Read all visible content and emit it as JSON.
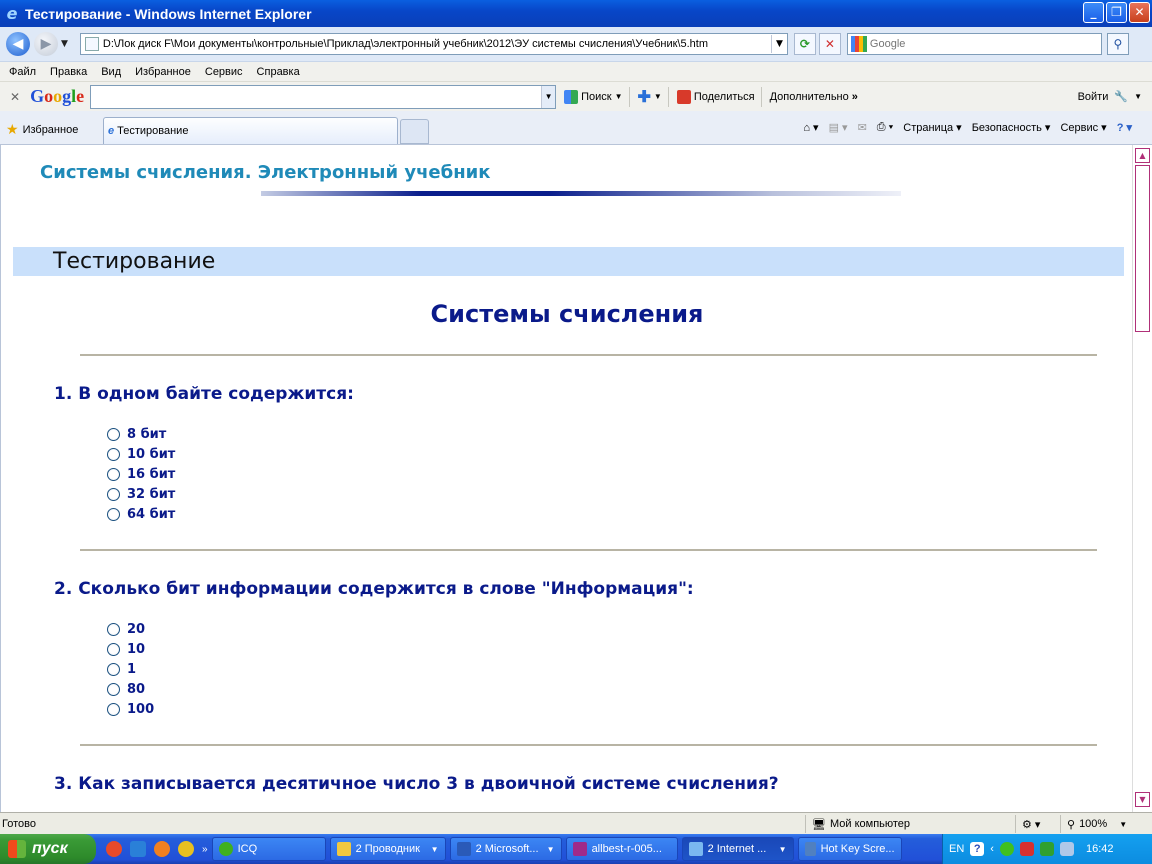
{
  "window": {
    "title": "Тестирование - Windows Internet Explorer"
  },
  "address": {
    "url": "D:\\Лок диск F\\Мои документы\\контрольные\\Приклад\\электронный учебник\\2012\\ЭУ системы счисления\\Учебник\\5.htm",
    "search_placeholder": "Google"
  },
  "menu": [
    "Файл",
    "Правка",
    "Вид",
    "Избранное",
    "Сервис",
    "Справка"
  ],
  "google_toolbar": {
    "logo": "Google",
    "search_label": "Поиск",
    "share_label": "Поделиться",
    "more_label": "Дополнительно",
    "login_label": "Войти"
  },
  "tabs": {
    "favorites_label": "Избранное",
    "active_tab": "Тестирование",
    "commands": {
      "page": "Страница",
      "safety": "Безопасность",
      "tools": "Сервис"
    }
  },
  "page": {
    "site_title": "Системы счисления. Электронный учебник",
    "section": "Тестирование",
    "heading": "Системы счисления",
    "questions": [
      {
        "text": "1. В одном байте содержится:",
        "options": [
          "8 бит",
          "10 бит",
          "16 бит",
          "32 бит",
          "64 бит"
        ]
      },
      {
        "text": "2. Сколько бит информации содержится в слове \"Информация\":",
        "options": [
          "20",
          "10",
          "1",
          "80",
          "100"
        ]
      },
      {
        "text": "3. Как записывается десятичное число 3 в двоичной системе счисления?",
        "options": []
      }
    ]
  },
  "statusbar": {
    "status": "Готово",
    "zone": "Мой компьютер",
    "zoom": "100%"
  },
  "taskbar": {
    "start": "пуск",
    "buttons": [
      "ICQ",
      "2 Проводник",
      "2 Microsoft...",
      "allbest-r-005...",
      "2 Internet ...",
      "Hot Key Scre..."
    ],
    "lang": "EN",
    "clock": "16:42"
  }
}
